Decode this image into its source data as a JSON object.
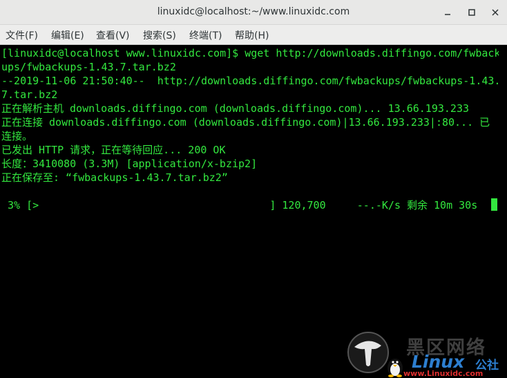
{
  "window": {
    "title": "linuxidc@localhost:~/www.linuxidc.com",
    "minimize_glyph": "—",
    "close_glyph": "✕"
  },
  "menu": {
    "items": [
      {
        "label": "文件(F)"
      },
      {
        "label": "编辑(E)"
      },
      {
        "label": "查看(V)"
      },
      {
        "label": "搜索(S)"
      },
      {
        "label": "终端(T)"
      },
      {
        "label": "帮助(H)"
      }
    ]
  },
  "terminal": {
    "lines": [
      "[linuxidc@localhost www.linuxidc.com]$ wget http://downloads.diffingo.com/fwbackups",
      "ups/fwbackups-1.43.7.tar.bz2",
      "--2019-11-06 21:50:40--  http://downloads.diffingo.com/fwbackups/fwbackups-1.43.",
      "7.tar.bz2",
      "正在解析主机 downloads.diffingo.com (downloads.diffingo.com)... 13.66.193.233",
      "正在连接 downloads.diffingo.com (downloads.diffingo.com)|13.66.193.233|:80... 已",
      "连接。",
      "已发出 HTTP 请求，正在等待回应... 200 OK",
      "长度：3410080 (3.3M) [application/x-bzip2]",
      "正在保存至: “fwbackups-1.43.7.tar.bz2”",
      "",
      " 3% [>                                     ] 120,700     --.-K/s 剩余 10m 30s"
    ],
    "text_color": "#33e83f",
    "background": "#000000"
  },
  "watermark": {
    "cn": "黑区网络",
    "linux": "Linux",
    "gongshe": "公社",
    "url": "www.Linuxidc.com"
  },
  "icons": {
    "minimize": "minimize-icon",
    "maximize": "maximize-icon",
    "close": "close-icon",
    "tux": "tux-penguin-icon"
  }
}
